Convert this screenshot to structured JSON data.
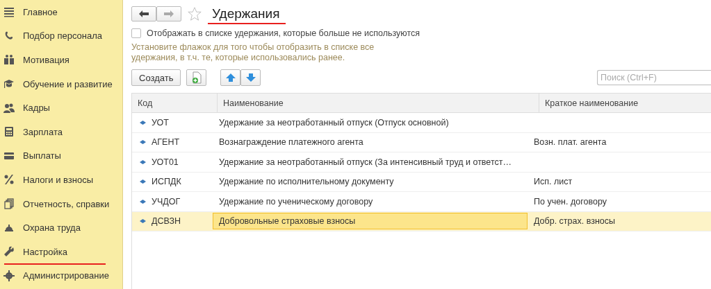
{
  "sidebar": {
    "items": [
      {
        "label": "Главное",
        "underlined": false
      },
      {
        "label": "Подбор персонала",
        "underlined": false
      },
      {
        "label": "Мотивация",
        "underlined": false
      },
      {
        "label": "Обучение и развитие",
        "underlined": false
      },
      {
        "label": "Кадры",
        "underlined": false
      },
      {
        "label": "Зарплата",
        "underlined": false
      },
      {
        "label": "Выплаты",
        "underlined": false
      },
      {
        "label": "Налоги и взносы",
        "underlined": false
      },
      {
        "label": "Отчетность, справки",
        "underlined": false
      },
      {
        "label": "Охрана труда",
        "underlined": false
      },
      {
        "label": "Настройка",
        "underlined": true
      },
      {
        "label": "Администрирование",
        "underlined": false
      }
    ]
  },
  "header": {
    "title": "Удержания",
    "title_underlined": true,
    "favorite": false
  },
  "show_unused": {
    "label": "Отображать в списке удержания, которые больше не используются",
    "checked": false
  },
  "hint": "Установите флажок для того чтобы отобразить в списке все удержания, в т.ч. те, которые использовались ранее.",
  "toolbar": {
    "create_label": "Создать"
  },
  "search": {
    "placeholder": "Поиск (Ctrl+F)"
  },
  "table": {
    "columns": [
      "Код",
      "Наименование",
      "Краткое наименование"
    ],
    "rows": [
      {
        "code": "УОТ",
        "name": "Удержание за неотработанный отпуск (Отпуск основной)",
        "short": "",
        "selected": false
      },
      {
        "code": "АГЕНТ",
        "name": "Вознаграждение платежного агента",
        "short": "Возн. плат. агента",
        "selected": false
      },
      {
        "code": "УОТ01",
        "name": "Удержание за неотработанный отпуск (За интенсивный труд и ответст…",
        "short": "",
        "selected": false
      },
      {
        "code": "ИСПДК",
        "name": "Удержание по исполнительному документу",
        "short": "Исп. лист",
        "selected": false
      },
      {
        "code": "УЧДОГ",
        "name": "Удержание по ученическому договору",
        "short": "По учен. договору",
        "selected": false
      },
      {
        "code": "ДСВЗН",
        "name": "Добровольные страховые взносы",
        "short": "Добр. страх. взносы",
        "selected": true
      }
    ]
  }
}
